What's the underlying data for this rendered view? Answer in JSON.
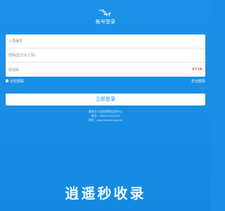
{
  "app": {
    "logo_icon": "bird-logo-icon",
    "title": "帐号登录"
  },
  "form": {
    "username_placeholder": "人员编号",
    "password_placeholder": "密码(区分大小写)",
    "captcha_placeholder": "验证码",
    "captcha_value": "6Y1N"
  },
  "options": {
    "remember_label": "记住密码",
    "forgot_label": "忘记密码"
  },
  "actions": {
    "login_label": "立即登录"
  },
  "footer": {
    "line1": "蓬莱市人民检察院信息中心",
    "line2": "电话：0535-XXXXXXX",
    "line3": "网址：www.xxxxxxx.gov.cn"
  },
  "watermark": {
    "text": "逍遥秒收录"
  },
  "colors": {
    "background": "#1a8fe6",
    "captcha": "#e05050"
  }
}
